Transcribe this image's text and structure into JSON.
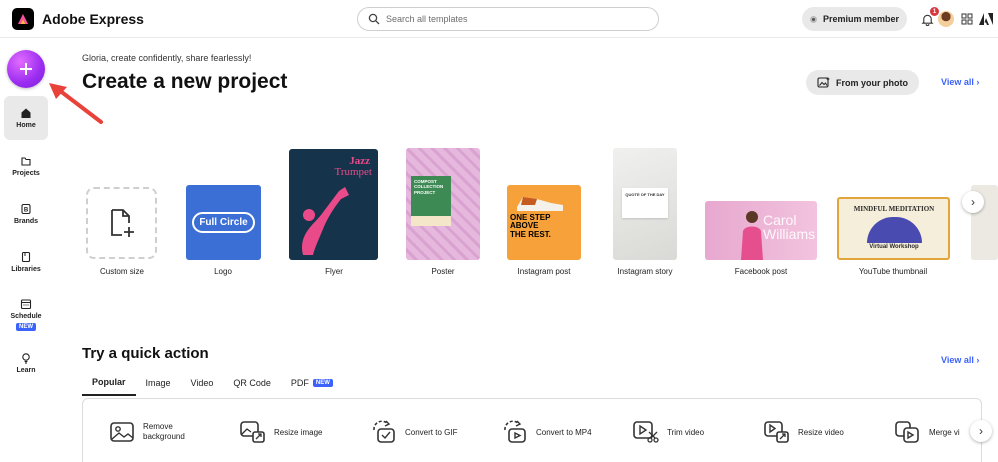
{
  "header": {
    "app_name": "Adobe Express",
    "search_placeholder": "Search all templates",
    "premium_label": "Premium member",
    "notification_count": "1"
  },
  "sidebar": {
    "items": [
      {
        "label": "Home",
        "icon": "home-icon"
      },
      {
        "label": "Projects",
        "icon": "projects-icon"
      },
      {
        "label": "Brands",
        "icon": "brands-icon"
      },
      {
        "label": "Libraries",
        "icon": "libraries-icon"
      },
      {
        "label": "Schedule",
        "icon": "calendar-icon",
        "badge": "NEW"
      },
      {
        "label": "Learn",
        "icon": "lightbulb-icon"
      }
    ]
  },
  "main": {
    "greeting": "Gloria, create confidently, share fearlessly!",
    "title": "Create a new project",
    "from_photo": "From your photo",
    "view_all": "View all",
    "templates": [
      {
        "label": "Custom size"
      },
      {
        "label": "Logo",
        "thumb_text": "Full Circle"
      },
      {
        "label": "Flyer",
        "thumb_title": "Jazz",
        "thumb_sub": "Trumpet"
      },
      {
        "label": "Poster",
        "thumb_text": "COMPOST COLLECTION PROJECT"
      },
      {
        "label": "Instagram post",
        "thumb_text": "ONE STEP ABOVE THE REST."
      },
      {
        "label": "Instagram story",
        "thumb_text": "QUOTE OF THE DAY"
      },
      {
        "label": "Facebook post",
        "thumb_text": "Carol Williams"
      },
      {
        "label": "YouTube thumbnail",
        "thumb_title": "MINDFUL MEDITATION",
        "thumb_sub": "Virtual Workshop"
      }
    ]
  },
  "quick": {
    "title": "Try a quick action",
    "view_all": "View all",
    "tabs": [
      {
        "label": "Popular"
      },
      {
        "label": "Image"
      },
      {
        "label": "Video"
      },
      {
        "label": "QR Code"
      },
      {
        "label": "PDF",
        "badge": "NEW"
      }
    ],
    "actions": [
      {
        "label": "Remove background"
      },
      {
        "label": "Resize image"
      },
      {
        "label": "Convert to GIF"
      },
      {
        "label": "Convert to MP4"
      },
      {
        "label": "Trim video"
      },
      {
        "label": "Resize video"
      },
      {
        "label": "Merge vi"
      }
    ]
  },
  "colors": {
    "accent": "#3b63fb",
    "create_button": "#9a2cf0",
    "arrow": "#e8423a"
  }
}
